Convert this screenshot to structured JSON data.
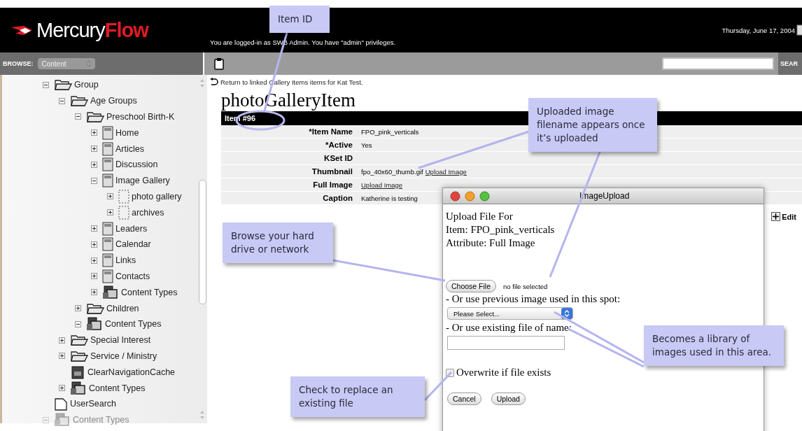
{
  "header": {
    "logo_left": "Mercury",
    "logo_right": "Flow",
    "login_text": "You are logged-in as SWB Admin. You have \"admin\" privileges.",
    "date": "Thursday, June 17, 2004"
  },
  "toolbar": {
    "browse_label": "BROWSE:",
    "browse_value": "Content",
    "search_button": "SEAR"
  },
  "tree": [
    {
      "label": "Group",
      "kind": "folder",
      "expanded": true,
      "disabled": false,
      "children": [
        {
          "label": "Age Groups",
          "kind": "folder",
          "expanded": true,
          "disabled": false,
          "children": [
            {
              "label": "Preschool Birth-K",
              "kind": "folder",
              "expanded": true,
              "disabled": false,
              "children": [
                {
                  "label": "Home",
                  "kind": "page",
                  "expanded": false,
                  "disabled": false
                },
                {
                  "label": "Articles",
                  "kind": "page",
                  "expanded": false,
                  "disabled": false
                },
                {
                  "label": "Discussion",
                  "kind": "page",
                  "expanded": false,
                  "disabled": false
                },
                {
                  "label": "Image Gallery",
                  "kind": "page",
                  "expanded": true,
                  "disabled": false,
                  "children": [
                    {
                      "label": "photo gallery",
                      "kind": "placeholder",
                      "expanded": false,
                      "disabled": false
                    },
                    {
                      "label": "archives",
                      "kind": "placeholder",
                      "expanded": false,
                      "disabled": false
                    }
                  ]
                },
                {
                  "label": "Leaders",
                  "kind": "page",
                  "expanded": false,
                  "disabled": false
                },
                {
                  "label": "Calendar",
                  "kind": "page",
                  "expanded": false,
                  "disabled": false
                },
                {
                  "label": "Links",
                  "kind": "page",
                  "expanded": false,
                  "disabled": false
                },
                {
                  "label": "Contacts",
                  "kind": "page",
                  "expanded": false,
                  "disabled": false
                },
                {
                  "label": "Content Types",
                  "kind": "types",
                  "expanded": false,
                  "disabled": false
                }
              ]
            },
            {
              "label": "Children",
              "kind": "folder",
              "expanded": false,
              "disabled": false
            },
            {
              "label": "Content Types",
              "kind": "types",
              "expanded": true,
              "disabled": false
            }
          ]
        },
        {
          "label": "Special Interest",
          "kind": "folder",
          "expanded": false,
          "disabled": false
        },
        {
          "label": "Service / Ministry",
          "kind": "folder",
          "expanded": false,
          "disabled": false
        },
        {
          "label": "ClearNavigationCache",
          "kind": "cache",
          "disabled": false
        },
        {
          "label": "Content Types",
          "kind": "types",
          "expanded": false,
          "disabled": false
        }
      ]
    },
    {
      "label": "UserSearch",
      "kind": "search",
      "disabled": false
    },
    {
      "label": "Content Types",
      "kind": "types",
      "expanded": true,
      "disabled": true
    }
  ],
  "content": {
    "back_link": "Return to linked Gallery Items items for Kat Test.",
    "heading": "photoGalleryItem",
    "item_bar": "Item #96",
    "fields": [
      {
        "label": "*Item Name",
        "value": "FPO_pink_verticals"
      },
      {
        "label": "*Active",
        "value": "Yes"
      },
      {
        "label": "KSet ID"
      },
      {
        "label": "Thumbnail",
        "value": "fpo_40x60_thumb.gif",
        "link": "Upload Image"
      },
      {
        "label": "Full Image",
        "link": "Upload Image"
      },
      {
        "label": "Caption",
        "value": "Katherine is testing"
      }
    ],
    "edit": "Edit"
  },
  "dialog": {
    "title": "ImageUpload",
    "lines": [
      "Upload File For",
      "Item: FPO_pink_verticals",
      "Attribute: Full Image"
    ],
    "choose_button": "Choose File",
    "file_status": "no file selected",
    "previous_label": "- Or use previous image used in this spot:",
    "select": "Please Select...",
    "name_label": "- Or use existing file of name:",
    "overwrite": {
      "label": "Overwrite if file exists",
      "checked": false
    },
    "buttons": [
      "Cancel",
      "Upload"
    ]
  },
  "callouts": [
    {
      "text": "Item ID"
    },
    {
      "text": "Uploaded image filename appears once it’s uploaded"
    },
    {
      "text": "Browse your hard drive or network"
    },
    {
      "text": "Becomes a library of images used in this area."
    },
    {
      "text": "Check to replace an existing file"
    }
  ]
}
